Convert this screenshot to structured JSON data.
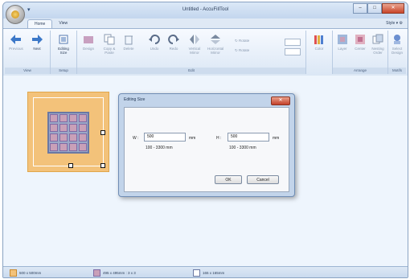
{
  "window": {
    "title": "Untitled - AccuFillTool",
    "qat": "▾",
    "min": "–",
    "max": "□",
    "close": "✕"
  },
  "tabs": [
    {
      "label": "Home"
    },
    {
      "label": "View"
    }
  ],
  "style_link": "Style ▾ ⚙",
  "ribbon": {
    "groups": {
      "view": "View",
      "setup": "Setup",
      "edit": "Edit",
      "arrange": "Arrange",
      "motifs": "Motifs"
    },
    "buttons": {
      "previous": "Previous",
      "next": "Next",
      "editing_size": "Editing Size",
      "design": "Design",
      "copy_paste": "Copy & Paste",
      "delete": "Delete",
      "undo": "Undo",
      "redo": "Redo",
      "vertical_mirror": "Vertical Mirror",
      "horizontal_mirror": "Horizontal Mirror",
      "rotate": "Rotate",
      "numeric1": "Rotate",
      "color": "Color",
      "layer": "Layer",
      "center": "Center",
      "nesting_order": "Nesting Order",
      "select_design": "Select Design"
    }
  },
  "dialog": {
    "title": "Editing Size",
    "close": "✕",
    "width_label": "W :",
    "width_value": "500",
    "width_unit": "mm",
    "width_range": "100 - 3300 mm",
    "height_label": "H :",
    "height_value": "500",
    "height_unit": "mm",
    "height_range": "100 - 3300 mm",
    "ok": "OK",
    "cancel": "Cancel"
  },
  "status": {
    "hoop": "500 x 500mm",
    "grid": "495 x 495mm : 3 x 3",
    "design": "165 x 165mm"
  },
  "colors": {
    "hoop": "#f3c27a",
    "grid_fill": "#c9a0b8",
    "grid_line": "#6a78a3",
    "accent": "#2c4d79"
  }
}
